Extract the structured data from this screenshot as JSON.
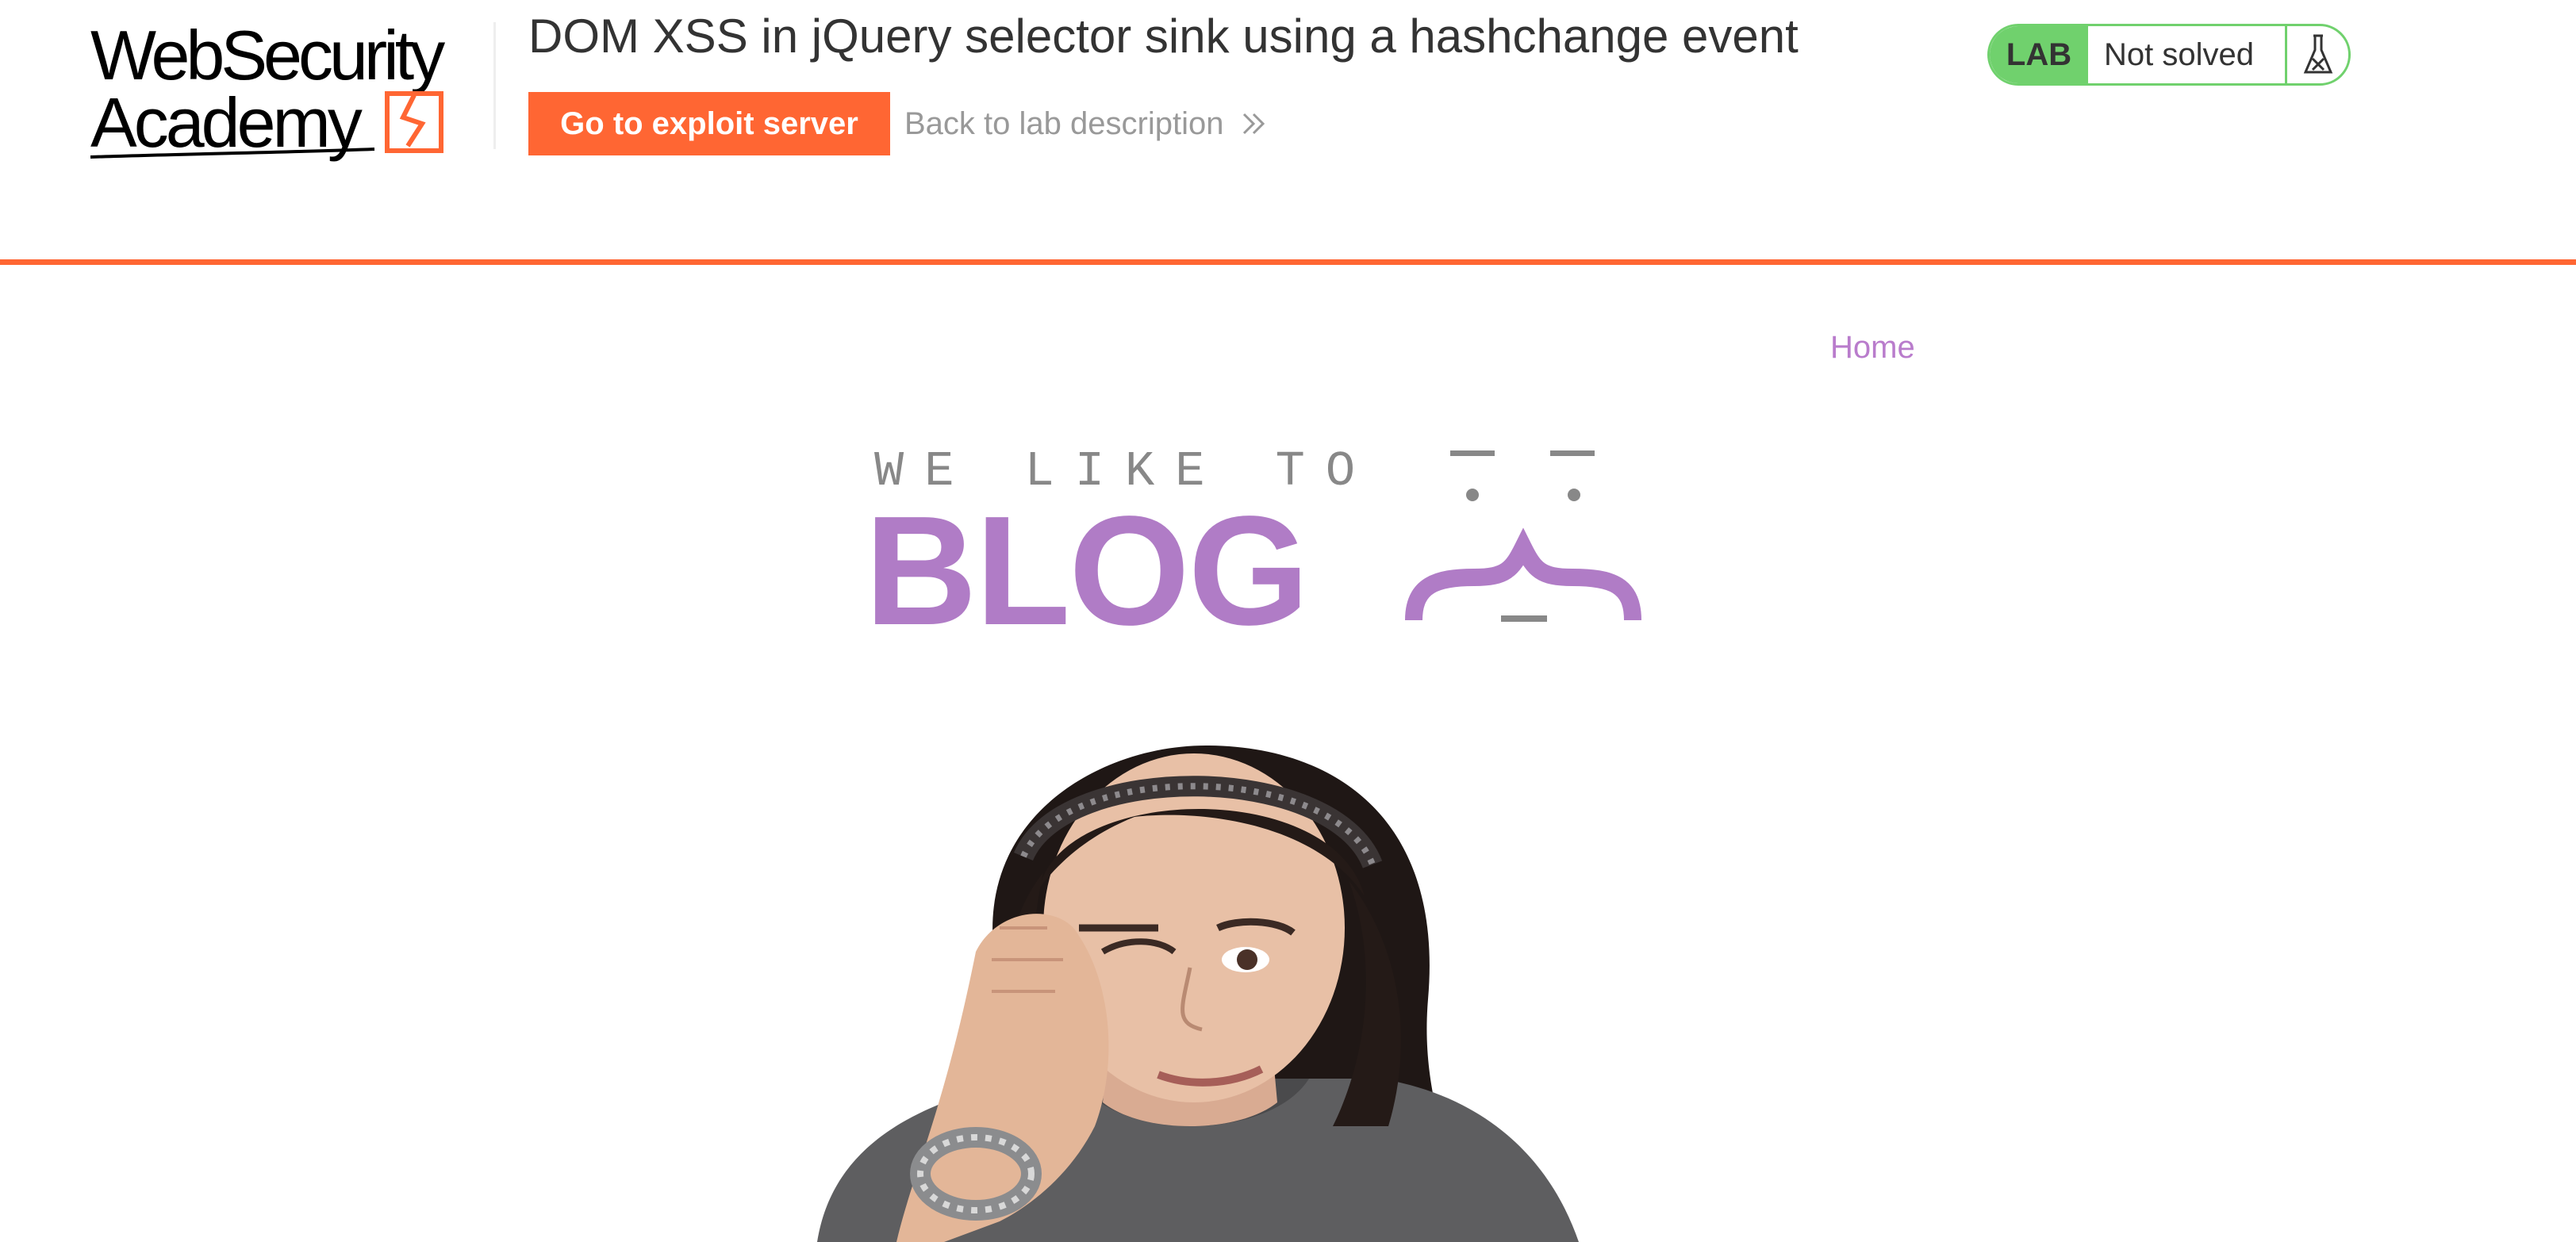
{
  "academy": {
    "logo": {
      "line1": "WebSecurity",
      "line2": "Academy"
    },
    "lab_title": "DOM XSS in jQuery selector sink using a hashchange event",
    "exploit_button": "Go to exploit server",
    "back_link": "Back to lab description",
    "lab_badge": "LAB",
    "lab_status": "Not solved",
    "accent_color": "#ff6633",
    "status_color": "#70d16d",
    "icons": [
      "chevrons-right-icon",
      "flask-icon"
    ]
  },
  "blog": {
    "nav": {
      "home": "Home"
    },
    "banner": {
      "tagline": "WE LIKE TO",
      "word": "BLOG"
    },
    "brand_color": "#b07cc6",
    "hero_image": "photo of a bored teenage girl resting her chin on her hand"
  }
}
